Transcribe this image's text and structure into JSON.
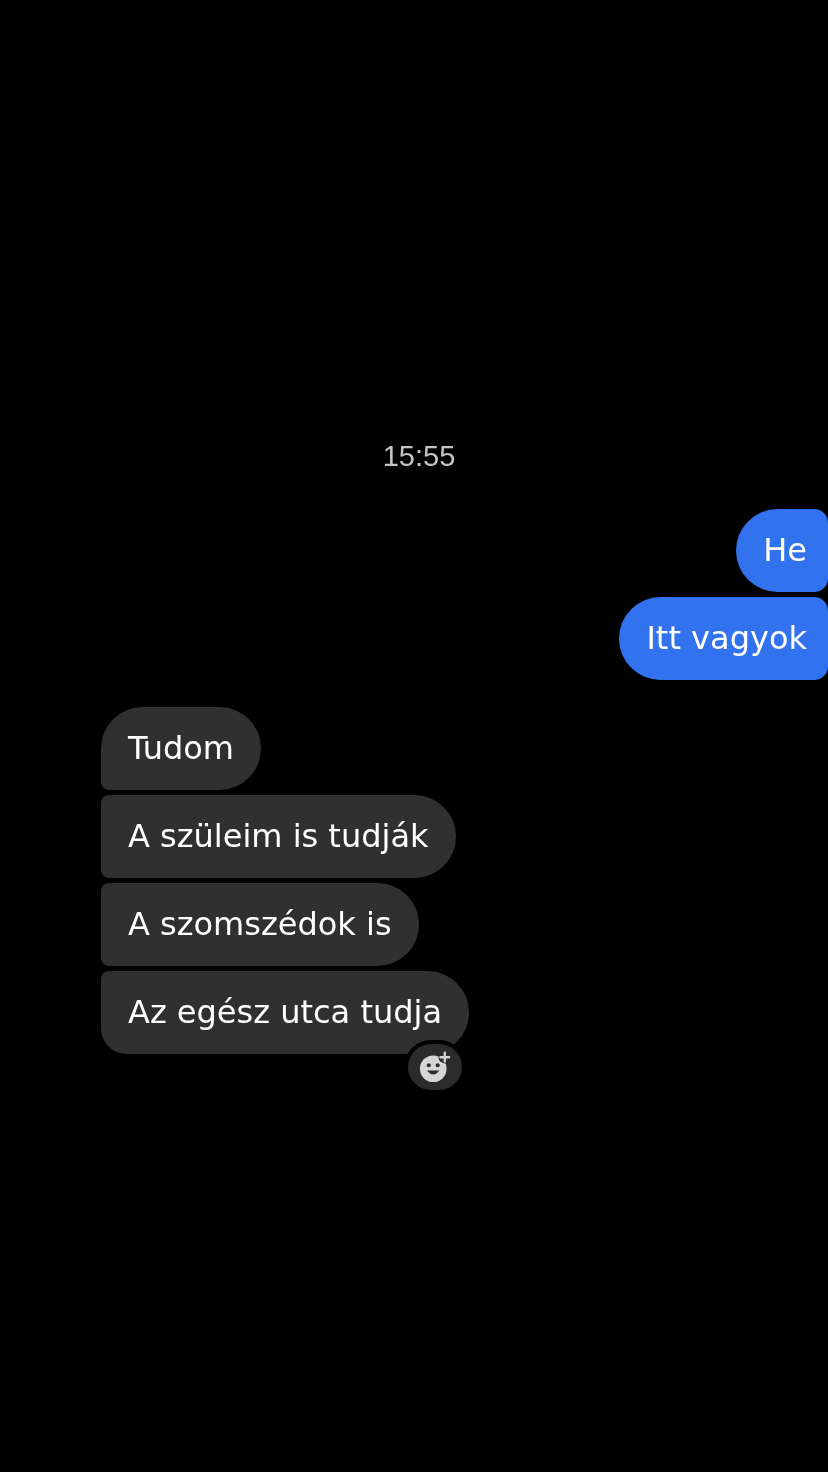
{
  "timestamp": "15:55",
  "messages": [
    {
      "kind": "sent",
      "text": "He",
      "reaction_button": false
    },
    {
      "kind": "sent",
      "text": "Itt vagyok",
      "reaction_button": false
    },
    {
      "kind": "received",
      "text": "Tudom",
      "reaction_button": false
    },
    {
      "kind": "received",
      "text": "A szüleim is tudják",
      "reaction_button": false
    },
    {
      "kind": "received",
      "text": "A szomszédok is",
      "reaction_button": false
    },
    {
      "kind": "received",
      "text": "Az egész utca tudja",
      "reaction_button": true
    }
  ]
}
